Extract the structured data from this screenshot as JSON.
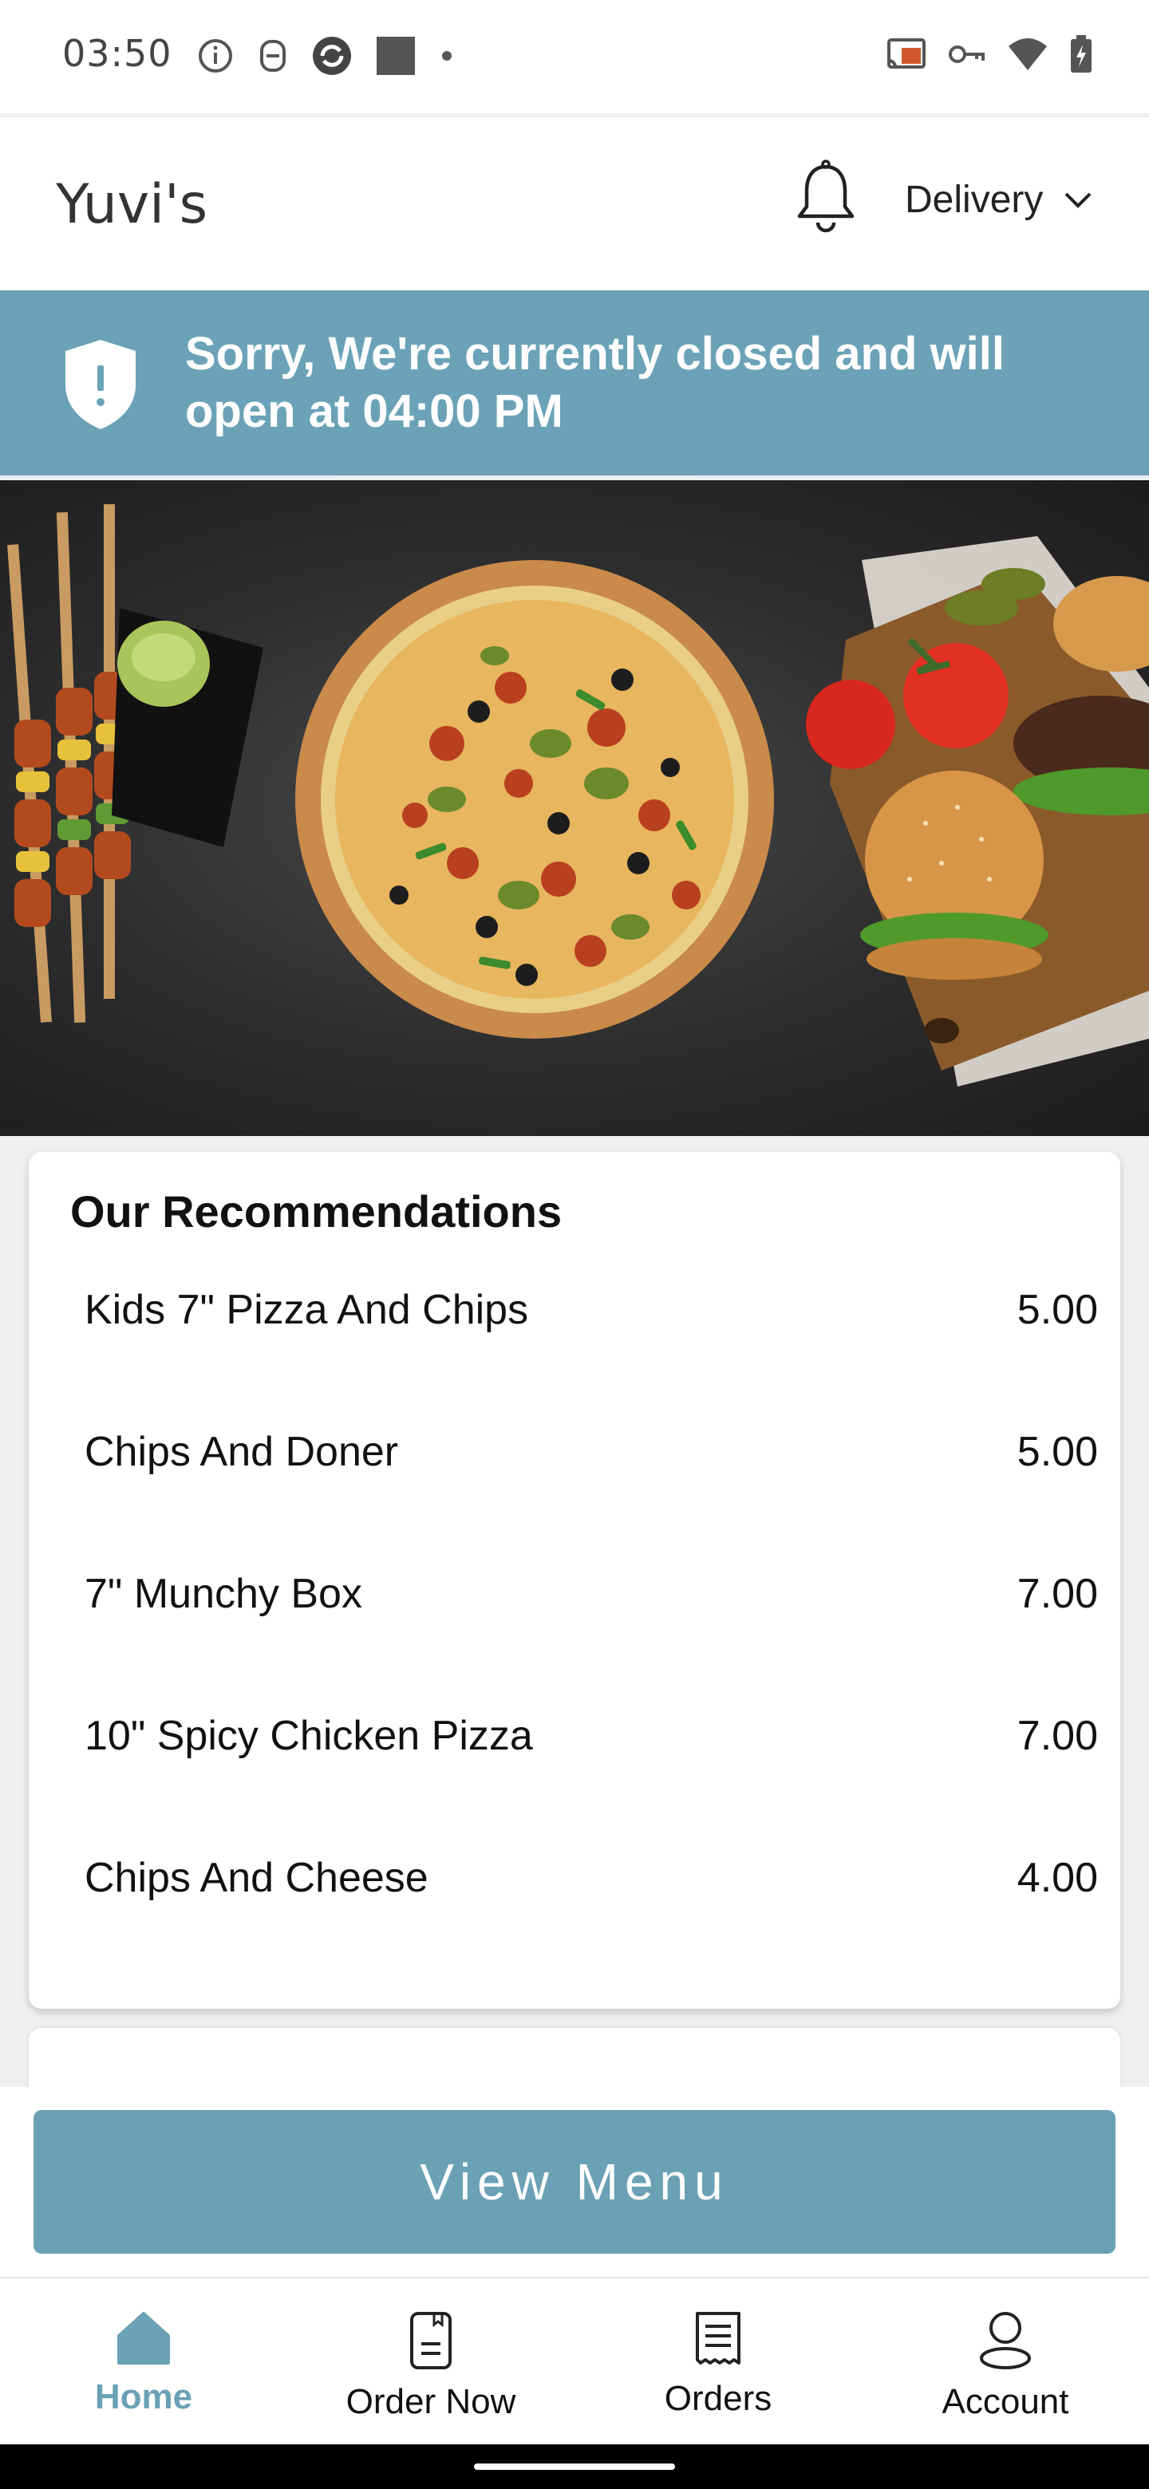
{
  "status_bar": {
    "time": "03:50",
    "left_icons": [
      "info-icon",
      "notification-app-icon",
      "sync-icon",
      "square-app-icon",
      "dot-icon"
    ],
    "right_icons": [
      "cast-icon",
      "key-icon",
      "wifi-icon",
      "battery-icon"
    ]
  },
  "header": {
    "brand": "Yuvi's",
    "notification_icon": "bell-icon",
    "order_mode": "Delivery"
  },
  "closed_banner": {
    "message": "Sorry, We're currently closed and will open at 04:00 PM",
    "icon": "shield-alert-icon"
  },
  "hero": {
    "description_icon": "food-banner"
  },
  "recommendations": {
    "title": "Our Recommendations",
    "items": [
      {
        "name": "Kids 7\" Pizza And Chips",
        "price": "5.00"
      },
      {
        "name": "Chips And Doner",
        "price": "5.00"
      },
      {
        "name": "7\" Munchy Box",
        "price": "7.00"
      },
      {
        "name": "10\" Spicy Chicken Pizza",
        "price": "7.00"
      },
      {
        "name": "Chips And Cheese",
        "price": "4.00"
      }
    ]
  },
  "actions": {
    "view_menu": "View Menu"
  },
  "bottom_nav": {
    "items": [
      {
        "label": "Home",
        "icon": "home-icon",
        "active": true
      },
      {
        "label": "Order Now",
        "icon": "order-book-icon",
        "active": false
      },
      {
        "label": "Orders",
        "icon": "receipt-icon",
        "active": false
      },
      {
        "label": "Account",
        "icon": "person-icon",
        "active": false
      }
    ]
  },
  "colors": {
    "accent": "#6aa1b5",
    "banner": "#6ba2b7"
  }
}
